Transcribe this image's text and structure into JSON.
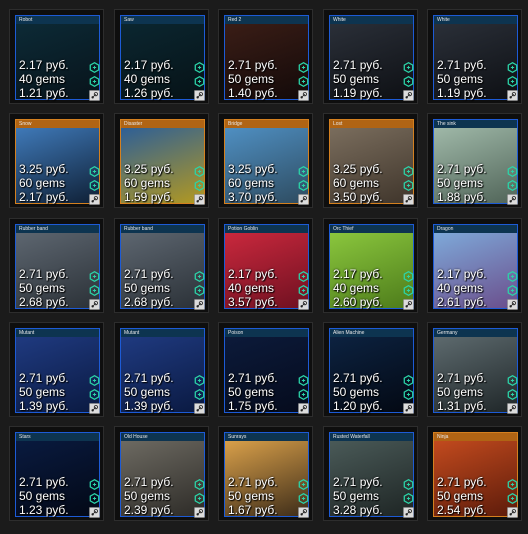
{
  "cards": [
    {
      "title": "Robot",
      "price": "2.17 руб.",
      "gems": "40 gems",
      "lowest": "1.21 руб.",
      "colors": [
        "#0c2a36",
        "#08131a"
      ],
      "border": "#1d5bd6",
      "hdr": "#0d3450"
    },
    {
      "title": "Saw",
      "price": "2.17 руб.",
      "gems": "40 gems",
      "lowest": "1.26 руб.",
      "colors": [
        "#0b2630",
        "#061216"
      ],
      "border": "#1d5bd6",
      "hdr": "#0d3450"
    },
    {
      "title": "Red 2",
      "price": "2.71 руб.",
      "gems": "50 gems",
      "lowest": "1.40 руб.",
      "colors": [
        "#3a1d16",
        "#120909"
      ],
      "border": "#1d5bd6",
      "hdr": "#0d3450"
    },
    {
      "title": "White",
      "price": "2.71 руб.",
      "gems": "50 gems",
      "lowest": "1.19 руб.",
      "colors": [
        "#2a2f38",
        "#0d0f13"
      ],
      "border": "#1d5bd6",
      "hdr": "#0d3450"
    },
    {
      "title": "White",
      "price": "2.71 руб.",
      "gems": "50 gems",
      "lowest": "1.19 руб.",
      "colors": [
        "#2a2f38",
        "#0d0f13"
      ],
      "border": "#1d5bd6",
      "hdr": "#0d3450"
    },
    {
      "title": "Snow",
      "price": "3.25 руб.",
      "gems": "60 gems",
      "lowest": "2.17 руб.",
      "colors": [
        "#3f79b8",
        "#0e1e33"
      ],
      "border": "#d4801f",
      "hdr": "#b06414"
    },
    {
      "title": "Disaster",
      "price": "3.25 руб.",
      "gems": "60 gems",
      "lowest": "1.59 руб.",
      "colors": [
        "#2e5f96",
        "#b59a1e"
      ],
      "border": "#d4801f",
      "hdr": "#b06414"
    },
    {
      "title": "Bridge",
      "price": "3.25 руб.",
      "gems": "60 gems",
      "lowest": "3.70 руб.",
      "colors": [
        "#4f8fc2",
        "#2d4a5e"
      ],
      "border": "#d4801f",
      "hdr": "#b06414"
    },
    {
      "title": "Lost",
      "price": "3.25 руб.",
      "gems": "60 gems",
      "lowest": "3.50 руб.",
      "colors": [
        "#7a6d5d",
        "#3e342a"
      ],
      "border": "#d4801f",
      "hdr": "#b06414"
    },
    {
      "title": "The sink",
      "price": "2.71 руб.",
      "gems": "50 gems",
      "lowest": "1.88 руб.",
      "colors": [
        "#9fb8a8",
        "#4f6357"
      ],
      "border": "#1d5bd6",
      "hdr": "#0d3450"
    },
    {
      "title": "Rubber band",
      "price": "2.71 руб.",
      "gems": "50 gems",
      "lowest": "2.68 руб.",
      "colors": [
        "#5d6670",
        "#2a3036"
      ],
      "border": "#1d5bd6",
      "hdr": "#0d3450"
    },
    {
      "title": "Rubber band",
      "price": "2.71 руб.",
      "gems": "50 gems",
      "lowest": "2.68 руб.",
      "colors": [
        "#5d6670",
        "#2a3036"
      ],
      "border": "#1d5bd6",
      "hdr": "#0d3450"
    },
    {
      "title": "Potion Goblin",
      "price": "2.17 руб.",
      "gems": "40 gems",
      "lowest": "3.57 руб.",
      "colors": [
        "#c9283d",
        "#6d1020"
      ],
      "border": "#1d5bd6",
      "hdr": "#0d3450"
    },
    {
      "title": "Orc Thief",
      "price": "2.17 руб.",
      "gems": "40 gems",
      "lowest": "2.60 руб.",
      "colors": [
        "#8ac63d",
        "#4c7a1a"
      ],
      "border": "#1d5bd6",
      "hdr": "#0d3450"
    },
    {
      "title": "Dragon",
      "price": "2.17 руб.",
      "gems": "40 gems",
      "lowest": "2.61 руб.",
      "colors": [
        "#7ea9d9",
        "#6a4c8a"
      ],
      "border": "#1d5bd6",
      "hdr": "#0d3450"
    },
    {
      "title": "Mutant",
      "price": "2.71 руб.",
      "gems": "50 gems",
      "lowest": "1.39 руб.",
      "colors": [
        "#1f3a80",
        "#0a1940"
      ],
      "border": "#1d5bd6",
      "hdr": "#0d3450"
    },
    {
      "title": "Mutant",
      "price": "2.71 руб.",
      "gems": "50 gems",
      "lowest": "1.39 руб.",
      "colors": [
        "#1f3a80",
        "#0a1940"
      ],
      "border": "#1d5bd6",
      "hdr": "#0d3450"
    },
    {
      "title": "Poison",
      "price": "2.71 руб.",
      "gems": "50 gems",
      "lowest": "1.75 руб.",
      "colors": [
        "#0c1a3a",
        "#050b1c"
      ],
      "border": "#1d5bd6",
      "hdr": "#0d3450"
    },
    {
      "title": "Alien Machine",
      "price": "2.71 руб.",
      "gems": "50 gems",
      "lowest": "1.20 руб.",
      "colors": [
        "#0c2240",
        "#030812"
      ],
      "border": "#1d5bd6",
      "hdr": "#0d3450"
    },
    {
      "title": "Germany",
      "price": "2.71 руб.",
      "gems": "50 gems",
      "lowest": "1.31 руб.",
      "colors": [
        "#5d6a6e",
        "#1e2527"
      ],
      "border": "#1d5bd6",
      "hdr": "#0d3450"
    },
    {
      "title": "Stars",
      "price": "2.71 руб.",
      "gems": "50 gems",
      "lowest": "1.23 руб.",
      "colors": [
        "#091a3f",
        "#030815"
      ],
      "border": "#1d5bd6",
      "hdr": "#0d3450"
    },
    {
      "title": "Old House",
      "price": "2.71 руб.",
      "gems": "50 gems",
      "lowest": "2.39 руб.",
      "colors": [
        "#6d6a62",
        "#2c2a26"
      ],
      "border": "#1d5bd6",
      "hdr": "#0d3450"
    },
    {
      "title": "Sunrays",
      "price": "2.71 руб.",
      "gems": "50 gems",
      "lowest": "1.67 руб.",
      "colors": [
        "#d9a04a",
        "#3a2a18"
      ],
      "border": "#1d5bd6",
      "hdr": "#0d3450"
    },
    {
      "title": "Rusted Waterfall",
      "price": "2.71 руб.",
      "gems": "50 gems",
      "lowest": "3.28 руб.",
      "colors": [
        "#4a5a58",
        "#1d2423"
      ],
      "border": "#1d5bd6",
      "hdr": "#0d3450"
    },
    {
      "title": "Ninja",
      "price": "2.71 руб.",
      "gems": "50 gems",
      "lowest": "2.54 руб.",
      "colors": [
        "#c24a1e",
        "#5a1a0a"
      ],
      "border": "#d4801f",
      "hdr": "#b06414"
    }
  ],
  "icons": {
    "gem": "gem-hex-icon",
    "steam": "steam-icon"
  },
  "colors": {
    "accent": "#2bd4a8"
  }
}
